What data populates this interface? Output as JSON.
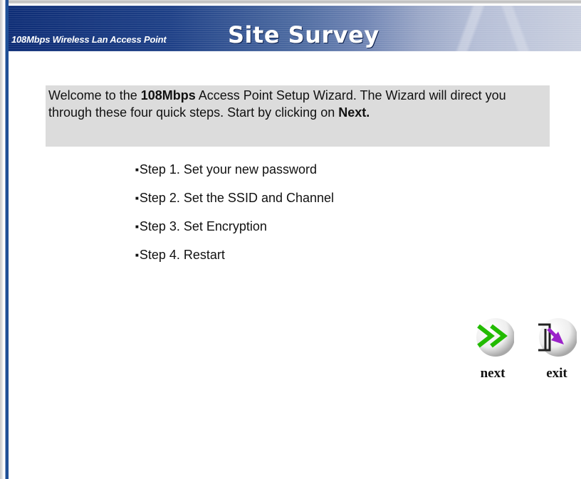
{
  "banner": {
    "subtitle": "108Mbps Wireless Lan Access Point",
    "title": "Site Survey"
  },
  "welcome": {
    "part1": "Welcome to the ",
    "bold1": "108Mbps",
    "part2": " Access Point Setup Wizard. The Wizard will direct you through these four quick steps. Start by clicking on ",
    "bold2": "Next."
  },
  "steps": [
    {
      "label": "Step 1. Set your new password"
    },
    {
      "label": "Step 2. Set the SSID and Channel"
    },
    {
      "label": "Step 3. Set Encryption"
    },
    {
      "label": "Step 4. Restart"
    }
  ],
  "bullet": "■",
  "buttons": {
    "next": {
      "label": "next",
      "icon": "next-arrows-icon",
      "color": "#22bb00"
    },
    "exit": {
      "label": "exit",
      "icon": "exit-arrow-icon",
      "color": "#9b22c9"
    }
  },
  "colors": {
    "banner_start": "#0e2d76",
    "welcome_bg": "#dcdcdc"
  }
}
